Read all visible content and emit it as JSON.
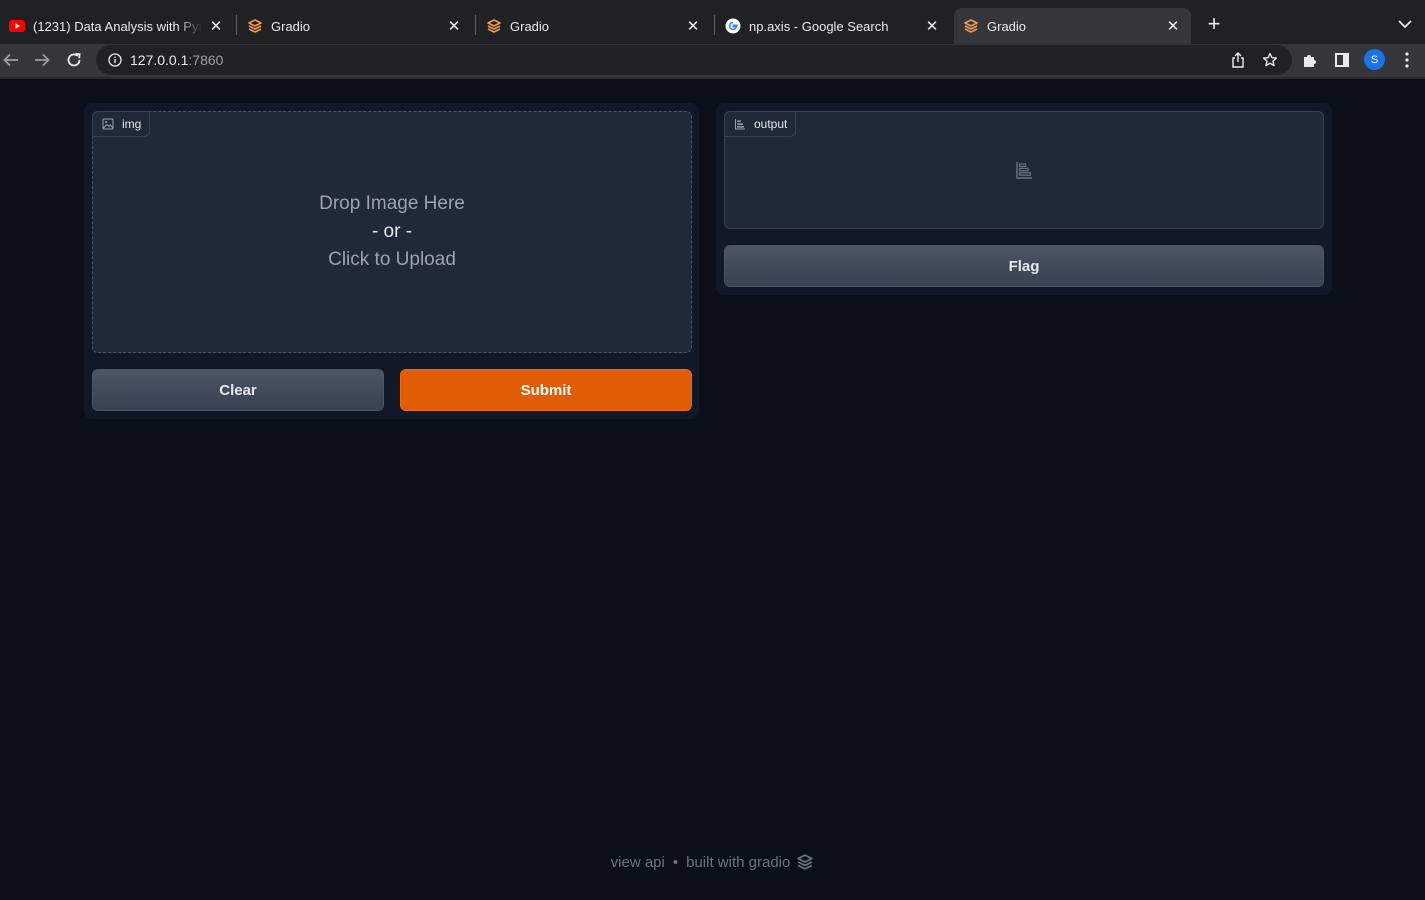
{
  "browser": {
    "tabs": [
      {
        "title": "(1231) Data Analysis with Python - YouTube",
        "favicon": "youtube-icon",
        "active": false
      },
      {
        "title": "Gradio",
        "favicon": "gradio-icon",
        "active": false
      },
      {
        "title": "Gradio",
        "favicon": "gradio-icon",
        "active": false
      },
      {
        "title": "np.axis - Google Search",
        "favicon": "google-icon",
        "active": false
      },
      {
        "title": "Gradio",
        "favicon": "gradio-icon",
        "active": true
      }
    ],
    "address": {
      "host": "127.0.0.1",
      "port": ":7860"
    },
    "profile_initial": "S"
  },
  "app": {
    "input": {
      "label": "img",
      "drop_text": "Drop Image Here",
      "or_text": "- or -",
      "click_text": "Click to Upload"
    },
    "buttons": {
      "clear": "Clear",
      "submit": "Submit",
      "flag": "Flag"
    },
    "output": {
      "label": "output"
    },
    "footer": {
      "view_api": "view api",
      "separator": "•",
      "built_with": "built with gradio"
    }
  },
  "colors": {
    "page_bg": "#0b0f19",
    "panel_bg": "#111827",
    "block_bg": "#1f2937",
    "primary": "#e05d06",
    "secondary": "#4b5563",
    "gradio_orange": "#f29a54"
  }
}
